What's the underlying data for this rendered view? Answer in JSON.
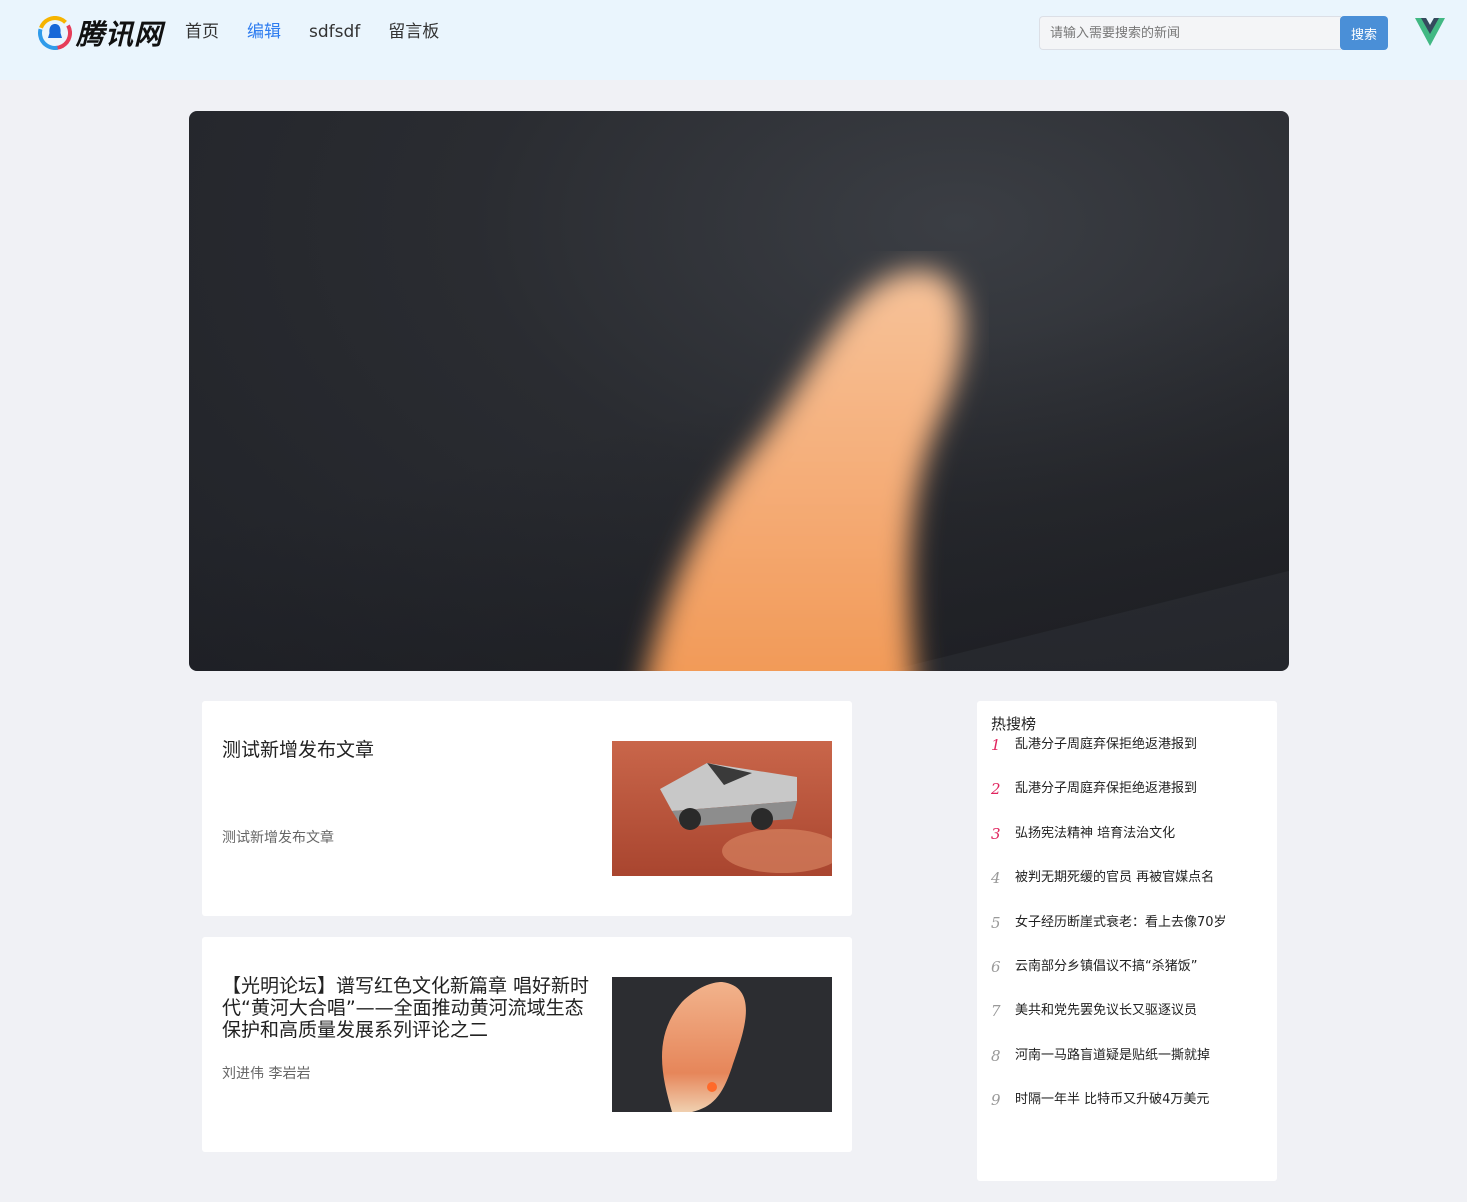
{
  "header": {
    "logo_text": "腾讯网",
    "nav": [
      "首页",
      "编辑",
      "sdfsdf",
      "留言板"
    ],
    "active_nav": 1,
    "search": {
      "placeholder": "请输入需要搜索的新闻",
      "button_label": "搜索"
    }
  },
  "banner": {
    "icon": "banner-image"
  },
  "articles": [
    {
      "title": "测试新增发布文章",
      "subtitle": "测试新增发布文章"
    },
    {
      "title": "【光明论坛】谱写红色文化新篇章 唱好新时代“黄河大合唱”——全面推动黄河流域生态保护和高质量发展系列评论之二",
      "subtitle": "刘进伟 李岩岩"
    }
  ],
  "hot": {
    "title": "热搜榜",
    "items": [
      {
        "rank": "1",
        "text": "乱港分子周庭弃保拒绝返港报到"
      },
      {
        "rank": "2",
        "text": "乱港分子周庭弃保拒绝返港报到"
      },
      {
        "rank": "3",
        "text": "弘扬宪法精神 培育法治文化"
      },
      {
        "rank": "4",
        "text": "被判无期死缓的官员 再被官媒点名"
      },
      {
        "rank": "5",
        "text": "女子经历断崖式衰老：看上去像70岁"
      },
      {
        "rank": "6",
        "text": "云南部分乡镇倡议不搞“杀猪饭”"
      },
      {
        "rank": "7",
        "text": "美共和党先罢免议长又驱逐议员"
      },
      {
        "rank": "8",
        "text": "河南一马路盲道疑是贴纸一撕就掉"
      },
      {
        "rank": "9",
        "text": "时隔一年半 比特币又升破4万美元"
      }
    ]
  },
  "colors": {
    "accent": "#2d7cf0",
    "hot_rank": "#e0245e",
    "search_button": "#4a8fd7"
  }
}
